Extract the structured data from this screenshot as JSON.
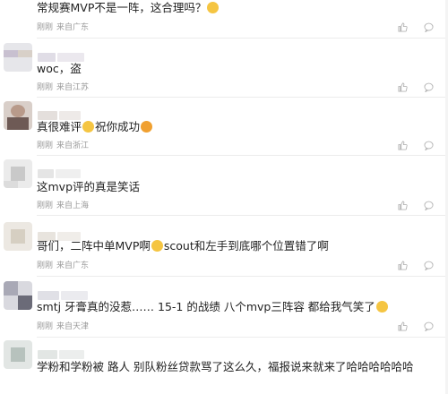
{
  "comments": [
    {
      "text": "常规赛MVP不是一阵，这合理吗？",
      "time": "刚刚",
      "location": "来自广东",
      "emoji_color": "#f5c542"
    },
    {
      "text": "woc，盗",
      "time": "刚刚",
      "location": "来自江苏"
    },
    {
      "text_before": "真很难评",
      "text_mid": "祝你成功",
      "time": "刚刚",
      "location": "来自浙江",
      "emoji_color": "#f5c542",
      "emoji2_color": "#f0a030"
    },
    {
      "text": "这mvp评的真是笑话",
      "time": "刚刚",
      "location": "来自上海"
    },
    {
      "text_before": "哥们，二阵中单MVP啊",
      "text_after": "scout和左手到底哪个位置错了啊",
      "time": "刚刚",
      "location": "来自广东",
      "emoji_color": "#f5c542"
    },
    {
      "text": "smtj 牙膏真的没惹…… 15-1 的战绩 八个mvp三阵容 都给我气笑了",
      "time": "刚刚",
      "location": "来自天津",
      "emoji_color": "#f5c542"
    },
    {
      "text": "学粉和学粉被 路人 别队粉丝贷款骂了这么久，福报说来就来了哈哈哈哈哈哈",
      "time": "",
      "location": ""
    }
  ],
  "icons": {
    "like": "thumbs-up-icon",
    "reply": "comment-bubble-icon"
  },
  "colors": {
    "meta": "#999999",
    "icon": "#b5b5b5",
    "divider": "#ececec"
  }
}
